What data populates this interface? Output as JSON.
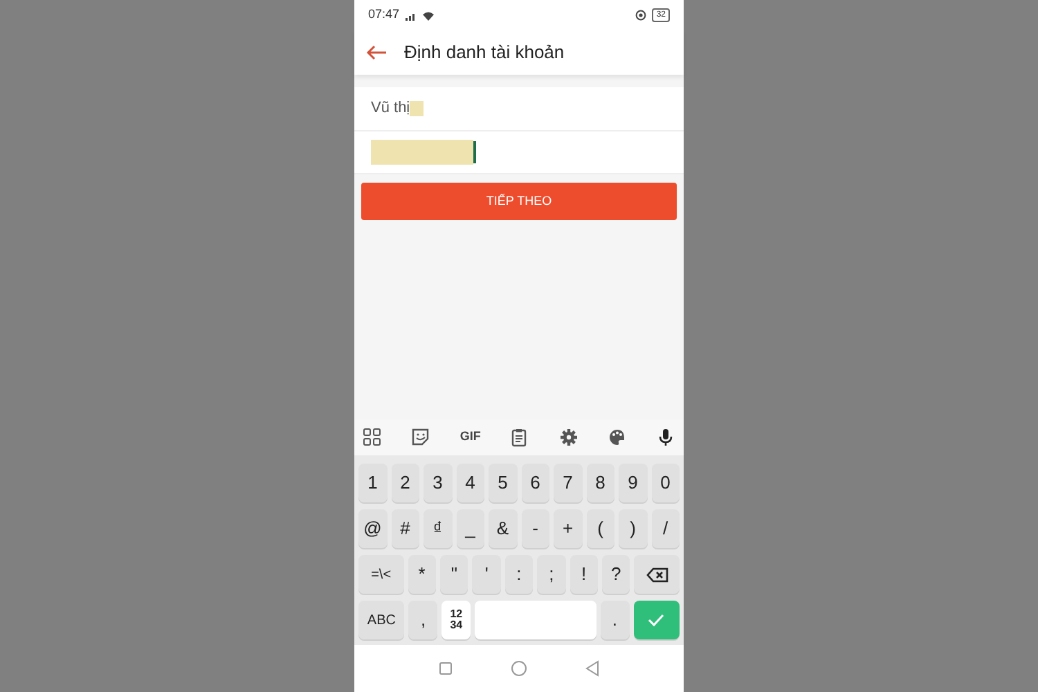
{
  "status_bar": {
    "time": "07:47",
    "battery": "32"
  },
  "header": {
    "title": "Định danh tài khoản"
  },
  "form": {
    "name_value": "Vũ thị",
    "submit_label": "TIẾP THEO"
  },
  "keyboard_toolbar": [
    {
      "kind": "grid"
    },
    {
      "kind": "sticker"
    },
    {
      "kind": "text",
      "label": "GIF"
    },
    {
      "kind": "clipboard"
    },
    {
      "kind": "gear"
    },
    {
      "kind": "palette"
    },
    {
      "kind": "mic"
    }
  ],
  "keyboard_rows": [
    [
      {
        "kind": "char",
        "label": "1"
      },
      {
        "kind": "char",
        "label": "2"
      },
      {
        "kind": "char",
        "label": "3"
      },
      {
        "kind": "char",
        "label": "4"
      },
      {
        "kind": "char",
        "label": "5"
      },
      {
        "kind": "char",
        "label": "6"
      },
      {
        "kind": "char",
        "label": "7"
      },
      {
        "kind": "char",
        "label": "8"
      },
      {
        "kind": "char",
        "label": "9"
      },
      {
        "kind": "char",
        "label": "0"
      }
    ],
    [
      {
        "kind": "char",
        "label": "@"
      },
      {
        "kind": "char",
        "label": "#"
      },
      {
        "kind": "char",
        "label": "₫"
      },
      {
        "kind": "char",
        "label": "_"
      },
      {
        "kind": "char",
        "label": "&"
      },
      {
        "kind": "char",
        "label": "-"
      },
      {
        "kind": "char",
        "label": "+"
      },
      {
        "kind": "char",
        "label": "("
      },
      {
        "kind": "char",
        "label": ")"
      },
      {
        "kind": "char",
        "label": "/"
      }
    ],
    [
      {
        "kind": "function",
        "label": "=\\<"
      },
      {
        "kind": "char",
        "label": "*"
      },
      {
        "kind": "char",
        "label": "\""
      },
      {
        "kind": "char",
        "label": "'"
      },
      {
        "kind": "char",
        "label": ":"
      },
      {
        "kind": "char",
        "label": ";"
      },
      {
        "kind": "char",
        "label": "!"
      },
      {
        "kind": "char",
        "label": "?"
      },
      {
        "kind": "backspace"
      }
    ],
    [
      {
        "kind": "function",
        "label": "ABC"
      },
      {
        "kind": "char",
        "label": ","
      },
      {
        "kind": "numpad",
        "lines": [
          "12",
          "34"
        ]
      },
      {
        "kind": "space"
      },
      {
        "kind": "char",
        "label": "."
      },
      {
        "kind": "enter"
      }
    ]
  ]
}
